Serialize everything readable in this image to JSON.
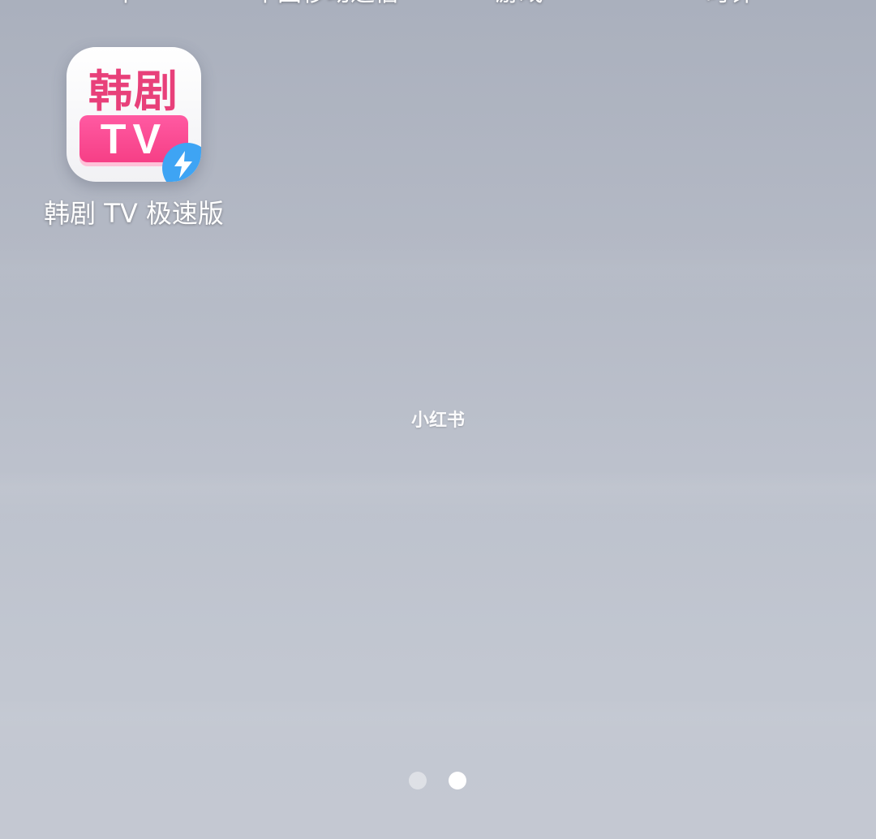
{
  "top_row_labels": [
    "中",
    "中国移动通信",
    "游戏",
    "时钟"
  ],
  "app": {
    "icon_title": "韩剧",
    "icon_tv": "TV",
    "label": "韩剧 TV 极速版",
    "badge_icon": "lightning-icon",
    "colors": {
      "brand_pink": "#f63f86",
      "title_pink": "#e8407a",
      "badge_blue": "#3ea4f4"
    }
  },
  "watermark": "小红书",
  "pager": {
    "page_count": 2,
    "active_page": 2
  }
}
